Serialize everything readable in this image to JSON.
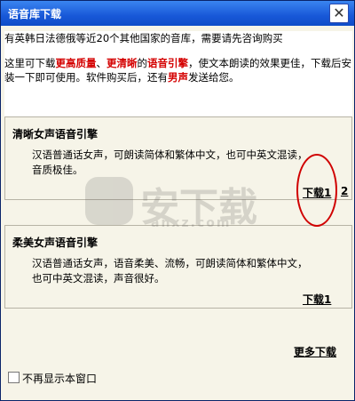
{
  "window": {
    "title": "语音库下载",
    "close_symbol": "✕"
  },
  "intro": {
    "line1": "有英韩日法德俄等近20个其他国家的音库，需要请先咨询购买",
    "p2_a": "这里可下载",
    "p2_b": "更高质量",
    "p2_c": "、",
    "p2_d": "更清晰",
    "p2_e": "的",
    "p2_f": "语音引擎",
    "p2_g": "，使文本朗读的效果更佳，下载后安装一下即可使用。软件购买后，还有",
    "p2_h": "男声",
    "p2_i": "发送给您。"
  },
  "engines": [
    {
      "title": "清晰女声语音引擎",
      "description": "汉语普通话女声，可朗读简体和繁体中文，也可中英文混读，音质极佳。",
      "download_label": "下载1",
      "extra_link": "2"
    },
    {
      "title": "柔美女声语音引擎",
      "description": "汉语普通话女声，语音柔美、流畅，可朗读简体和繁体中文，也可中英文混读，声音很好。",
      "download_label": "下载1"
    }
  ],
  "more_downloads": "更多下载",
  "dont_show": "不再显示本窗口",
  "watermark": {
    "text": "安下载",
    "sub": "anxz.com"
  },
  "colors": {
    "highlight": "#d40000",
    "titlebar": "#1858d8",
    "annotation": "#d00000"
  }
}
